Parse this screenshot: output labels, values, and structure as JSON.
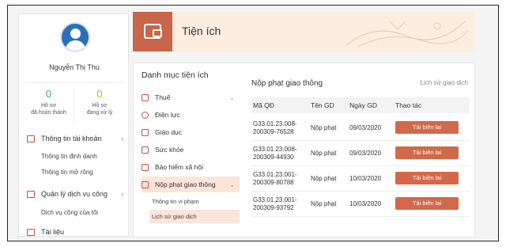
{
  "profile": {
    "name": "Nguyễn Thị Thu",
    "stats": [
      {
        "value": "0",
        "label_line1": "Hồ sơ",
        "label_line2": "đã hoàn thành"
      },
      {
        "value": "0",
        "label_line1": "Hồ sơ",
        "label_line2": "đang xử lý"
      }
    ]
  },
  "sidebar": {
    "sections": [
      {
        "label": "Thông tin tài khoản",
        "icon": "id-card-icon",
        "sub": [
          "Thông tin định danh",
          "Thông tin mở rộng"
        ]
      },
      {
        "label": "Quản lý dịch vụ công",
        "icon": "folder-icon",
        "sub": [
          "Dịch vụ công của tôi"
        ]
      },
      {
        "label": "Tài liệu",
        "icon": "document-icon",
        "sub": []
      }
    ]
  },
  "header": {
    "title": "Tiện ích",
    "icon": "wallet-icon"
  },
  "categories": {
    "title": "Danh mục tiện ích",
    "items": [
      {
        "label": "Thuế",
        "icon": "tax-icon"
      },
      {
        "label": "Điện lực",
        "icon": "electric-icon"
      },
      {
        "label": "Giáo dục",
        "icon": "education-icon"
      },
      {
        "label": "Sức khỏe",
        "icon": "health-icon"
      },
      {
        "label": "Bảo hiểm xã hội",
        "icon": "insurance-icon"
      },
      {
        "label": "Nộp phạt giao thông",
        "icon": "traffic-fine-icon"
      }
    ],
    "sub": [
      "Thông tin vi phạm",
      "Lịch sử giao dịch"
    ]
  },
  "content": {
    "title": "Nộp phạt giao thông",
    "history_link": "Lịch sử giao dịch",
    "columns": [
      "Mã QĐ",
      "Tên GD",
      "Ngày GD",
      "Thao tác"
    ],
    "rows": [
      {
        "code1": "G33.01.23.008-",
        "code2": "200309-76528",
        "name": "Nộp phạt",
        "date": "09/03/2020",
        "action": "Tải biên lai"
      },
      {
        "code1": "G33.01.23.008-",
        "code2": "200309-44930",
        "name": "Nộp phạt",
        "date": "09/03/2020",
        "action": "Tải biên lai"
      },
      {
        "code1": "G33.01.23.001-",
        "code2": "200309-80788",
        "name": "Nộp phạt",
        "date": "10/03/2020",
        "action": "Tải biên lai"
      },
      {
        "code1": "G33.01.23.001-",
        "code2": "200309-93792",
        "name": "Nộp phạt",
        "date": "10/03/2020",
        "action": "Tải biên lai"
      }
    ]
  },
  "colors": {
    "accent": "#c96548",
    "button": "#d2694a",
    "header_bg": "#fbeee0"
  }
}
